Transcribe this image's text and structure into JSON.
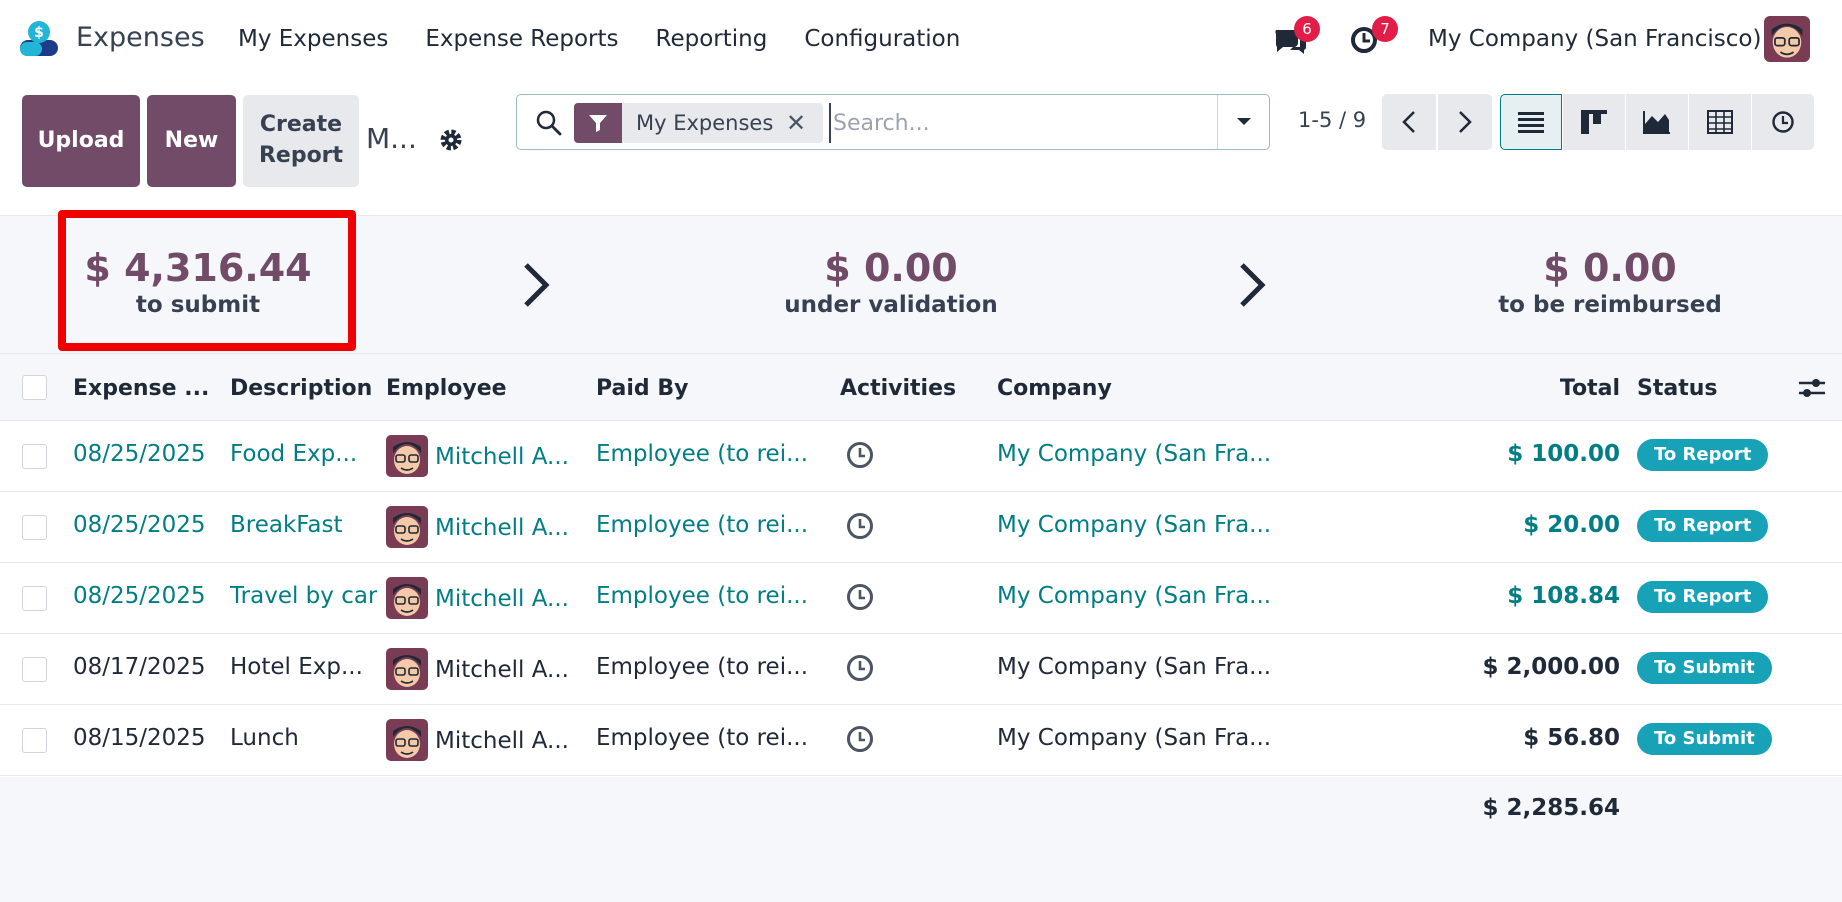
{
  "app": {
    "name": "Expenses"
  },
  "nav": {
    "items": [
      "My Expenses",
      "Expense Reports",
      "Reporting",
      "Configuration"
    ],
    "messages_count": "6",
    "activities_count": "7",
    "company": "My Company (San Francisco)"
  },
  "controls": {
    "upload_label": "Upload",
    "new_label": "New",
    "create_report_line1": "Create",
    "create_report_line2": "Report",
    "breadcrumb": "M...",
    "facet_label": "My Expenses",
    "facet_remove": "✕",
    "search_placeholder": "Search...",
    "pager": "1-5 / 9"
  },
  "stats": [
    {
      "amount": "$ 4,316.44",
      "label": "to submit"
    },
    {
      "amount": "$ 0.00",
      "label": "under validation"
    },
    {
      "amount": "$ 0.00",
      "label": "to be reimbursed"
    }
  ],
  "table": {
    "headers": {
      "date": "Expense ...",
      "description": "Description",
      "employee": "Employee",
      "paid_by": "Paid By",
      "activities": "Activities",
      "company": "Company",
      "total": "Total",
      "status": "Status"
    },
    "rows": [
      {
        "date": "08/25/2025",
        "description": "Food Exp...",
        "employee": "Mitchell A...",
        "paid_by": "Employee (to rei...",
        "company": "My Company (San Fra...",
        "total": "$ 100.00",
        "status": "To Report"
      },
      {
        "date": "08/25/2025",
        "description": "BreakFast",
        "employee": "Mitchell A...",
        "paid_by": "Employee (to rei...",
        "company": "My Company (San Fra...",
        "total": "$ 20.00",
        "status": "To Report"
      },
      {
        "date": "08/25/2025",
        "description": "Travel by car",
        "employee": "Mitchell A...",
        "paid_by": "Employee (to rei...",
        "company": "My Company (San Fra...",
        "total": "$ 108.84",
        "status": "To Report"
      },
      {
        "date": "08/17/2025",
        "description": "Hotel Exp...",
        "employee": "Mitchell A...",
        "paid_by": "Employee (to rei...",
        "company": "My Company (San Fra...",
        "total": "$ 2,000.00",
        "status": "To Submit"
      },
      {
        "date": "08/15/2025",
        "description": "Lunch",
        "employee": "Mitchell A...",
        "paid_by": "Employee (to rei...",
        "company": "My Company (San Fra...",
        "total": "$ 56.80",
        "status": "To Submit"
      }
    ],
    "grand_total": "$ 2,285.64"
  },
  "colors": {
    "brand": "#714b67",
    "link": "#017e84",
    "badge": "#17a2b8",
    "alert": "#e11d48",
    "highlight": "#f00000"
  }
}
